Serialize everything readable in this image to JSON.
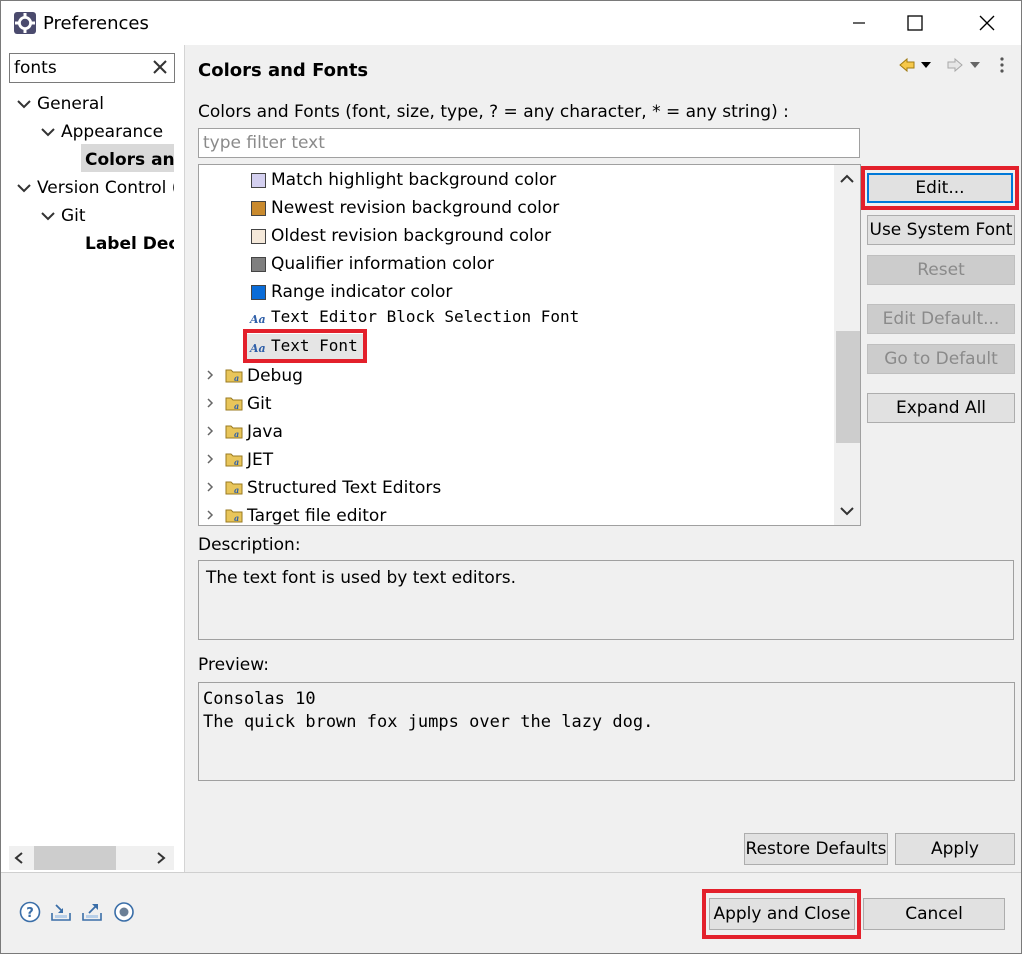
{
  "window": {
    "title": "Preferences",
    "controls": {
      "minimize": "minimize",
      "maximize": "maximize",
      "close": "close"
    }
  },
  "left": {
    "filter_value": "fonts",
    "tree": [
      {
        "label": "General",
        "expanded": true
      },
      {
        "label": "Appearance",
        "expanded": true
      },
      {
        "label": "Colors and Fonts",
        "selected": true
      },
      {
        "label": "Version Control (Team)",
        "expanded": true
      },
      {
        "label": "Git",
        "expanded": true
      },
      {
        "label": "Label Decorations"
      }
    ]
  },
  "page": {
    "title": "Colors and Fonts",
    "section_label": "Colors and Fonts (font, size, type, ? = any character, * = any string) :",
    "filter_placeholder": "type filter text",
    "tree_items": [
      {
        "label": "Match highlight background color",
        "kind": "color",
        "color": "#d4d0f0"
      },
      {
        "label": "Newest revision background color",
        "kind": "color",
        "color": "#c98a2e"
      },
      {
        "label": "Oldest revision background color",
        "kind": "color",
        "color": "#f5e9da"
      },
      {
        "label": "Qualifier information color",
        "kind": "color",
        "color": "#7f7f7f"
      },
      {
        "label": "Range indicator color",
        "kind": "color",
        "color": "#0a6cd8"
      },
      {
        "label": "Text Editor Block Selection Font",
        "kind": "font"
      },
      {
        "label": "Text Font",
        "kind": "font",
        "selected": true
      },
      {
        "label": "Debug",
        "kind": "category"
      },
      {
        "label": "Git",
        "kind": "category"
      },
      {
        "label": "Java",
        "kind": "category"
      },
      {
        "label": "JET",
        "kind": "category"
      },
      {
        "label": "Structured Text Editors",
        "kind": "category"
      },
      {
        "label": "Target file editor",
        "kind": "category"
      }
    ],
    "font_icon_text": "Aa",
    "buttons": {
      "edit": "Edit...",
      "use_system_font": "Use System Font",
      "reset": "Reset",
      "edit_default": "Edit Default...",
      "go_to_default": "Go to Default",
      "expand_all": "Expand All"
    },
    "description_label": "Description:",
    "description_text": "The text font is used by text editors.",
    "preview_label": "Preview:",
    "preview_lines": [
      "Consolas 10",
      "The quick brown fox jumps over the lazy dog."
    ],
    "restore_defaults": "Restore Defaults",
    "apply": "Apply"
  },
  "footer": {
    "apply_and_close": "Apply and Close",
    "cancel": "Cancel",
    "icons": [
      "help-icon",
      "import-icon",
      "export-icon",
      "record-icon"
    ]
  },
  "colors": {
    "highlight_red": "#e3202b",
    "panel_bg": "#f0f0f0",
    "selection_bg": "#d9d9d9"
  }
}
